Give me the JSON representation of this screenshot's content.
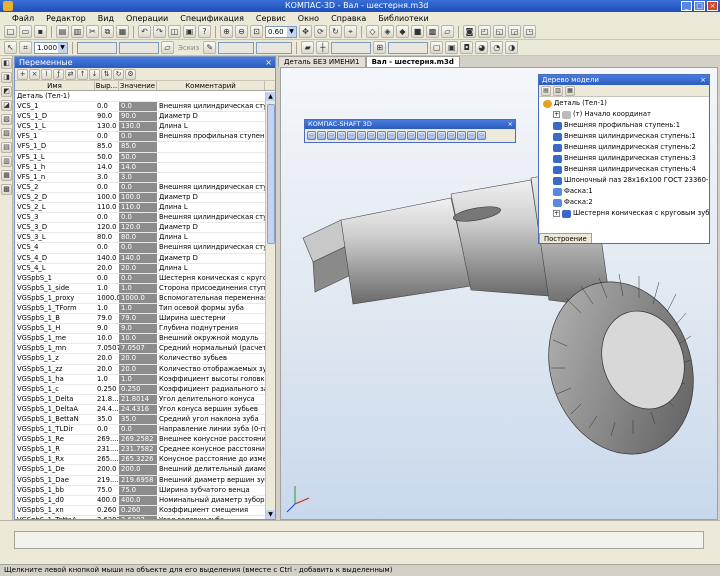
{
  "window": {
    "title": "КОМПАС-3D - Вал - шестерня.m3d"
  },
  "menu": [
    "Файл",
    "Редактор",
    "Вид",
    "Операции",
    "Спецификация",
    "Сервис",
    "Окно",
    "Справка",
    "Библиотеки"
  ],
  "toolbar": {
    "zoom_value": "0.60",
    "scale_value": "1.000",
    "sketch_label": "Эскиз"
  },
  "variables_panel": {
    "title": "Переменные",
    "headers": {
      "name": "Имя",
      "expr": "Выр...",
      "value": "Значение",
      "comment": "Комментарий"
    },
    "group": "Деталь (Тел-1)",
    "rows": [
      {
        "name": "VCS_1",
        "expr": "0.0",
        "value": "0.0",
        "comment": "Внешняя цилиндрическая ступень:1"
      },
      {
        "name": "VCS_1_D",
        "expr": "90.0",
        "value": "90.0",
        "comment": "Диаметр D"
      },
      {
        "name": "VCS_1_L",
        "expr": "130.0",
        "value": "130.0",
        "comment": "Длина L"
      },
      {
        "name": "VFS_1",
        "expr": "0.0",
        "value": "0.0",
        "comment": "Внешняя профильная ступень:1"
      },
      {
        "name": "VFS_1_D",
        "expr": "85.0",
        "value": "85.0",
        "comment": ""
      },
      {
        "name": "VFS_1_L",
        "expr": "50.0",
        "value": "50.0",
        "comment": ""
      },
      {
        "name": "VFS_1_h",
        "expr": "14.0",
        "value": "14.0",
        "comment": ""
      },
      {
        "name": "VFS_1_n",
        "expr": "3.0",
        "value": "3.0",
        "comment": ""
      },
      {
        "name": "VCS_2",
        "expr": "0.0",
        "value": "0.0",
        "comment": "Внешняя цилиндрическая ступень:2"
      },
      {
        "name": "VCS_2_D",
        "expr": "100.0",
        "value": "100.0",
        "comment": "Диаметр D"
      },
      {
        "name": "VCS_2_L",
        "expr": "110.0",
        "value": "110.0",
        "comment": "Длина L"
      },
      {
        "name": "VCS_3",
        "expr": "0.0",
        "value": "0.0",
        "comment": "Внешняя цилиндрическая ступень:3"
      },
      {
        "name": "VCS_3_D",
        "expr": "120.0",
        "value": "120.0",
        "comment": "Диаметр D"
      },
      {
        "name": "VCS_3_L",
        "expr": "80.0",
        "value": "80.0",
        "comment": "Длина L"
      },
      {
        "name": "VCS_4",
        "expr": "0.0",
        "value": "0.0",
        "comment": "Внешняя цилиндрическая ступень:4"
      },
      {
        "name": "VCS_4_D",
        "expr": "140.0",
        "value": "140.0",
        "comment": "Диаметр D"
      },
      {
        "name": "VCS_4_L",
        "expr": "20.0",
        "value": "20.0",
        "comment": "Длина L"
      },
      {
        "name": "VGSpbS_1",
        "expr": "0.0",
        "value": "0.0",
        "comment": "Шестерня коническая с круговым зуб"
      },
      {
        "name": "VGSpbS_1_side",
        "expr": "1.0",
        "value": "1.0",
        "comment": "Сторона присоединения ступени (0-н"
      },
      {
        "name": "VGSpbS_1_proxy",
        "expr": "1000.0",
        "value": "1000.0",
        "comment": "Вспомогательная переменная"
      },
      {
        "name": "VGSpbS_1_TForm",
        "expr": "1.0",
        "value": "1.0",
        "comment": "Тип осевой формы зуба"
      },
      {
        "name": "VGSpbS_1_B",
        "expr": "79.0",
        "value": "79.0",
        "comment": "Ширина шестерни"
      },
      {
        "name": "VGSpbS_1_H",
        "expr": "9.0",
        "value": "9.0",
        "comment": "Глубина поднутрения"
      },
      {
        "name": "VGSpbS_1_me",
        "expr": "10.0",
        "value": "10.0",
        "comment": "Внешний окружной модуль"
      },
      {
        "name": "VGSpbS_1_mn",
        "expr": "7.0507",
        "value": "7.0507",
        "comment": "Средний нормальный (расчетный) мо"
      },
      {
        "name": "VGSpbS_1_z",
        "expr": "20.0",
        "value": "20.0",
        "comment": "Количество зубьев"
      },
      {
        "name": "VGSpbS_1_zz",
        "expr": "20.0",
        "value": "20.0",
        "comment": "Количество отображаемых зубьев"
      },
      {
        "name": "VGSpbS_1_ha",
        "expr": "1.0",
        "value": "1.0",
        "comment": "Коэффициент высоты головки зуба"
      },
      {
        "name": "VGSpbS_1_c",
        "expr": "0.250",
        "value": "0.250",
        "comment": "Коэффициент радиального зазора"
      },
      {
        "name": "VGSpbS_1_Delta",
        "expr": "21.8...",
        "value": "21.8014",
        "comment": "Угол делительного конуса"
      },
      {
        "name": "VGSpbS_1_DeltaA",
        "expr": "24.4...",
        "value": "24.4316",
        "comment": "Угол конуса вершин зубьев"
      },
      {
        "name": "VGSpbS_1_BettaN",
        "expr": "35.0",
        "value": "35.0",
        "comment": "Средний угол наклона зуба"
      },
      {
        "name": "VGSpbS_1_TLDir",
        "expr": "0.0",
        "value": "0.0",
        "comment": "Направление линии зуба (0-правое)"
      },
      {
        "name": "VGSpbS_1_Re",
        "expr": "269....",
        "value": "269.2582",
        "comment": "Внешнее конусное расстояние"
      },
      {
        "name": "VGSpbS_1_R",
        "expr": "231....",
        "value": "231.7582",
        "comment": "Среднее конусное расстояние"
      },
      {
        "name": "VGSpbS_1_Rx",
        "expr": "265....",
        "value": "265.3226",
        "comment": "Конусное расстояние до измерительн"
      },
      {
        "name": "VGSpbS_1_De",
        "expr": "200.0",
        "value": "200.0",
        "comment": "Внешний делительный диаметр"
      },
      {
        "name": "VGSpbS_1_Dae",
        "expr": "219....",
        "value": "219.6958",
        "comment": "Внешний диаметр вершин зубьев"
      },
      {
        "name": "VGSpbS_1_bb",
        "expr": "75.0",
        "value": "75.0",
        "comment": "Ширина зубчатого венца"
      },
      {
        "name": "VGSpbS_1_d0",
        "expr": "400.0",
        "value": "400.0",
        "comment": "Номинальный диаметр зуборезной го"
      },
      {
        "name": "VGSpbS_1_xn",
        "expr": "0.260",
        "value": "0.260",
        "comment": "Коэффициент смещения"
      },
      {
        "name": "VGSpbS_1_TettaA",
        "expr": "2.6307",
        "value": "2.6307",
        "comment": "Угол головки зуба"
      }
    ]
  },
  "document": {
    "tabs": [
      "Деталь БЕЗ ИМЕНИ1",
      "Вал - шестерня.m3d"
    ]
  },
  "shaft_toolbar": {
    "title": "КОМПАС-SHAFT 3D"
  },
  "model_tree": {
    "title": "Дерево модели",
    "items": [
      {
        "label": "Деталь (Тел-1)",
        "icon": "part-icon",
        "expander": false
      },
      {
        "label": "(т) Начало координат",
        "icon": "coord-icon",
        "expander": true
      },
      {
        "label": "Внешняя профильная ступень:1",
        "icon": "feature-icon",
        "expander": false
      },
      {
        "label": "Внешняя цилиндрическая ступень:1",
        "icon": "feature-icon",
        "expander": false
      },
      {
        "label": "Внешняя цилиндрическая ступень:2",
        "icon": "feature-icon",
        "expander": false
      },
      {
        "label": "Внешняя цилиндрическая ступень:3",
        "icon": "feature-icon",
        "expander": false
      },
      {
        "label": "Внешняя цилиндрическая ступень:4",
        "icon": "feature-icon",
        "expander": false
      },
      {
        "label": "Шпоночный паз 28x16x100 ГОСТ 23360-78",
        "icon": "feature-icon",
        "expander": false
      },
      {
        "label": "Фаска:1",
        "icon": "chamfer-icon",
        "expander": false
      },
      {
        "label": "Фаска:2",
        "icon": "chamfer-icon",
        "expander": false
      },
      {
        "label": "Шестерня коническая с круговым зубом:1",
        "icon": "feature-icon",
        "expander": true
      }
    ],
    "bottom_tab": "Построение"
  },
  "status": {
    "text": "Щелкните левой кнопкой мыши на объекте для его выделения (вместе с Ctrl - добавить к выделенным)"
  },
  "colors": {
    "title_bar": "#2a5cc0",
    "panel_bg": "#ece9d8",
    "value_bg": "#8c8c8c"
  }
}
